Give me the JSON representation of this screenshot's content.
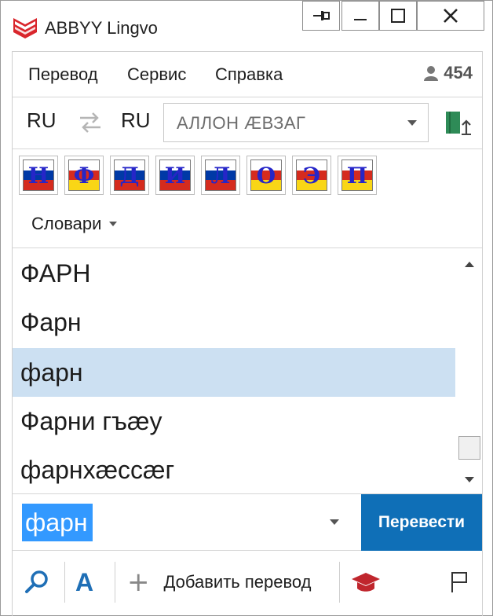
{
  "window": {
    "title": "ABBYY Lingvo",
    "buttons": [
      "pin",
      "minimize",
      "maximize",
      "close"
    ]
  },
  "menu": {
    "items": [
      "Перевод",
      "Сервис",
      "Справка"
    ],
    "user_count": "454"
  },
  "language": {
    "source": "RU",
    "target": "RU",
    "dictionary_selected": "АЛЛОН ÆВЗАГ"
  },
  "dictionaries": {
    "icons": [
      {
        "letter": "Н",
        "flag": "ru"
      },
      {
        "letter": "Ф",
        "flag": "os"
      },
      {
        "letter": "Д",
        "flag": "ru"
      },
      {
        "letter": "И",
        "flag": "ru"
      },
      {
        "letter": "Л",
        "flag": "ru"
      },
      {
        "letter": "О",
        "flag": "os"
      },
      {
        "letter": "Э",
        "flag": "os"
      },
      {
        "letter": "П",
        "flag": "os"
      }
    ],
    "menu_label": "Словари"
  },
  "wordlist": {
    "items": [
      "ФАРН",
      "Фарн",
      "фарн",
      "Фарни гъæу",
      "фарнхæссæг"
    ],
    "selected_index": 2
  },
  "search": {
    "value": "фарн",
    "translate_label": "Перевести"
  },
  "toolbar": {
    "font_label": "A",
    "add_translation_label": "Добавить перевод"
  },
  "colors": {
    "accent": "#0f6fb7",
    "selection": "#cce0f2",
    "highlight": "#3399ff"
  }
}
